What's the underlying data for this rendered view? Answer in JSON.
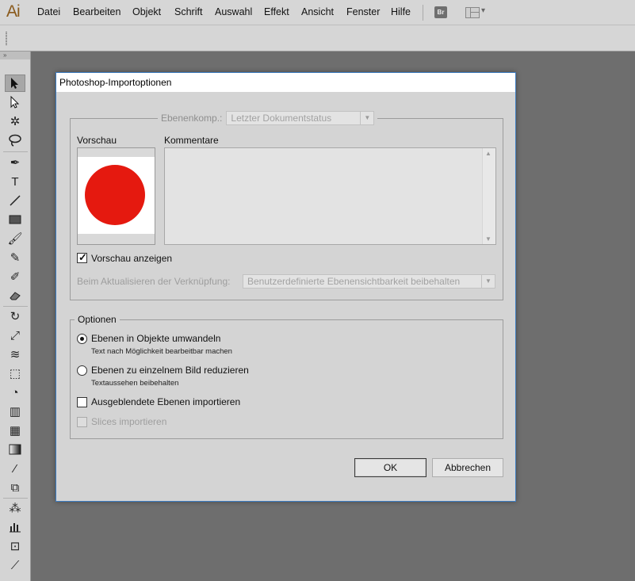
{
  "app": {
    "logo": "Ai",
    "menu": [
      "Datei",
      "Bearbeiten",
      "Objekt",
      "Schrift",
      "Auswahl",
      "Effekt",
      "Ansicht",
      "Fenster",
      "Hilfe"
    ],
    "bridge_label": "Br"
  },
  "tools": {
    "header": "»",
    "items": [
      "selection",
      "direct-selection",
      "magic-wand",
      "lasso",
      "pen",
      "type",
      "line-segment",
      "rectangle",
      "paintbrush",
      "pencil",
      "blob-brush",
      "eraser",
      "rotate",
      "scale",
      "width",
      "free-transform",
      "shape-builder",
      "perspective-grid",
      "mesh",
      "gradient",
      "eyedropper",
      "blend",
      "symbol-sprayer",
      "column-graph",
      "artboard",
      "slice"
    ]
  },
  "dialog": {
    "title": "Photoshop-Importoptionen",
    "layer_comp_label": "Ebenenkomp.:",
    "layer_comp_value": "Letzter Dokumentstatus",
    "preview_label": "Vorschau",
    "comments_label": "Kommentare",
    "comments_value": "",
    "show_preview_label": "Vorschau anzeigen",
    "show_preview_checked": true,
    "update_link_label": "Beim Aktualisieren der Verknüpfung:",
    "update_link_value": "Benutzerdefinierte Ebenensichtbarkeit beibehalten",
    "options_legend": "Optionen",
    "option1_label": "Ebenen in Objekte umwandeln",
    "option1_sub": "Text nach Möglichkeit bearbeitbar machen",
    "option1_selected": true,
    "option2_label": "Ebenen zu einzelnem Bild reduzieren",
    "option2_sub": "Textaussehen beibehalten",
    "hidden_layers_label": "Ausgeblendete Ebenen importieren",
    "slices_label": "Slices importieren",
    "ok_label": "OK",
    "cancel_label": "Abbrechen",
    "preview_circle_color": "#e5190f"
  }
}
